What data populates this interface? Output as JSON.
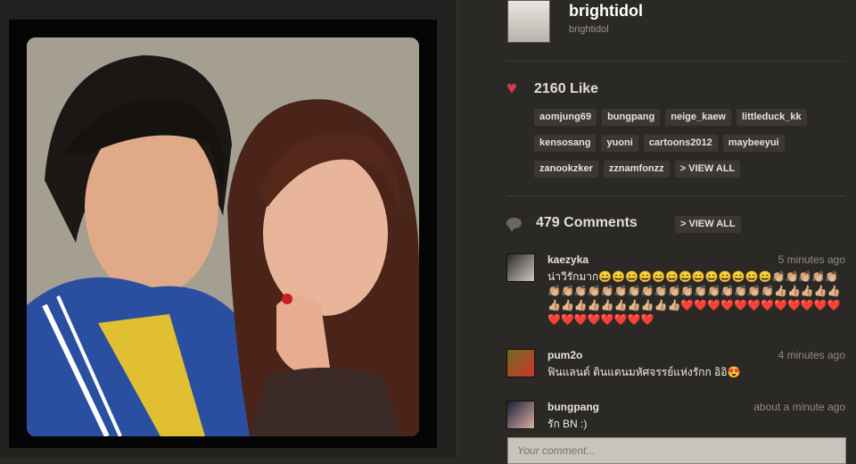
{
  "owner": {
    "name": "brightidol",
    "handle": "brightidol"
  },
  "likes": {
    "count_label": "2160 Like"
  },
  "likers": [
    "aomjung69",
    "bungpang",
    "neige_kaew",
    "littleduck_kk",
    "kensosang",
    "yuoni",
    "cartoons2012",
    "maybeeyui",
    "zanookzker",
    "zznamfonzz"
  ],
  "likers_view_all": "> VIEW ALL",
  "comments": {
    "count_label": "479 Comments",
    "view_all": "> VIEW ALL",
    "items": [
      {
        "user": "kaezyka",
        "time": "5 minutes ago",
        "text": "น่าวีรักมาก😄😄😄😄😄😄😄😄😄😄😄😄😄👏🏼👏🏼👏🏼👏🏼👏🏼👏🏼👏🏼👏🏼👏🏼👏🏼👏🏼👏🏼👏🏼👏🏼👏🏼👏🏼👏🏼👏🏼👏🏼👏🏼👏🏼👏🏼👍🏼👍🏼👍🏼👍🏼👍🏼👍🏼👍🏼👍🏼👍🏼👍🏼👍🏼👍🏼👍🏼👍🏼👍🏼❤️❤️❤️❤️❤️❤️❤️❤️❤️❤️❤️❤️❤️❤️❤️❤️❤️❤️❤️❤️"
      },
      {
        "user": "pum2o",
        "time": "4 minutes ago",
        "text": "ฟินแลนด์ ดินแดนมหัศจรรย์แห่งรักก อิอิ😍"
      },
      {
        "user": "bungpang",
        "time": "about a minute ago",
        "text": "รัก BN :)"
      }
    ]
  },
  "comment_box": {
    "placeholder": "Your comment..."
  }
}
